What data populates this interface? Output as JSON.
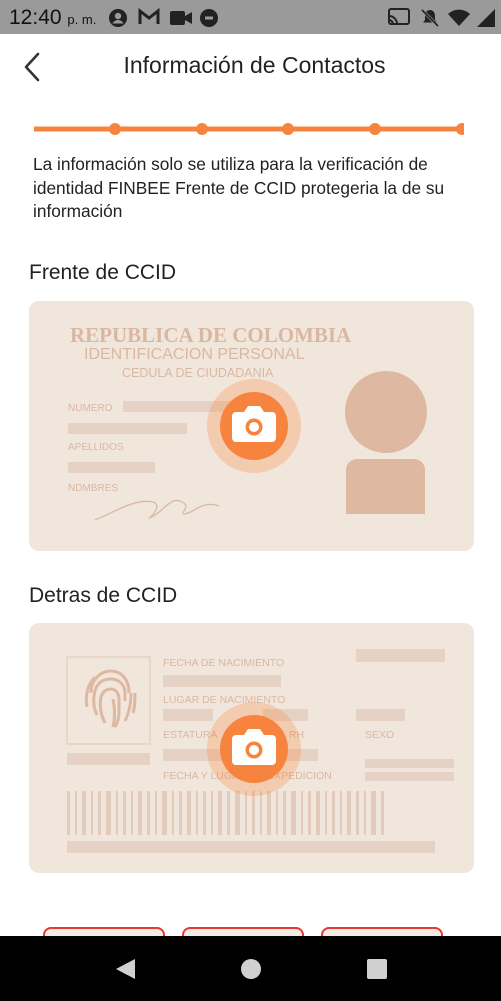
{
  "status_bar": {
    "time": "12:40",
    "ampm": "p. m."
  },
  "header": {
    "title": "Información de Contactos"
  },
  "progress": {
    "steps": 5,
    "completed": 5
  },
  "description": "La información solo se utiliza para la verificación de identidad FINBEE Frente de CCID protegeria la de su información",
  "front": {
    "label": "Frente de CCID",
    "card": {
      "title1": "REPUBLICA DE COLOMBIA",
      "title2": "IDENTIFICACION PERSONAL",
      "title3": "CEDULA DE CIUDADANIA",
      "field_numero": "NUMERO",
      "field_apellidos": "APELLIDOS",
      "field_nombres": "NDMBRES"
    }
  },
  "back": {
    "label": "Detras de CCID",
    "card": {
      "fecha_nacimiento": "FECHA DE NACIMIENTO",
      "lugar_nacimiento": "LUGAR DE NACIMIENTO",
      "estatura": "ESTATURA",
      "rh": "G.S. RH",
      "sexo": "SEXO",
      "fecha_lugar": "FECHA Y LUGAR DE EXPEDICION"
    }
  },
  "colors": {
    "accent": "#f7843e",
    "card_bg": "#f1e6dc",
    "card_ink": "#d9b8a2"
  }
}
